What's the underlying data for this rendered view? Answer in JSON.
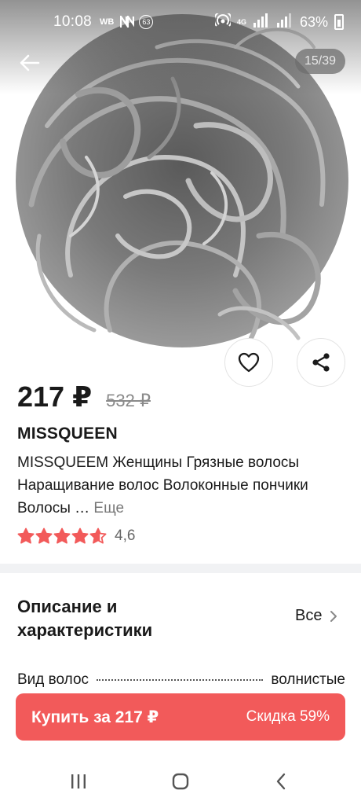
{
  "status_bar": {
    "time": "10:08",
    "carrier_badge": "WB",
    "notification_count": "63",
    "network_label": "4G",
    "battery": "63%"
  },
  "gallery": {
    "counter": "15/39",
    "image_description_icon": "hair-bun-photo"
  },
  "product": {
    "price": "217 ₽",
    "old_price": "532 ₽",
    "brand": "MISSQUEEN",
    "title": "MISSQUEEM Женщины Грязные волосы Наращивание волос Волоконные пончики Волосы …",
    "more_label": "Еще",
    "rating": 4.6,
    "rating_label": "4,6",
    "star_color": "#f25a5a"
  },
  "specs_section": {
    "title": "Описание и характеристики",
    "all_label": "Все",
    "rows": [
      {
        "name": "Вид волос",
        "value": "волнистые"
      }
    ]
  },
  "buy_bar": {
    "label": "Купить за 217 ₽",
    "discount": "Скидка 59%",
    "color": "#f25a5a"
  },
  "icons": {
    "back": "arrow-left-icon",
    "favorite": "heart-icon",
    "share": "share-icon",
    "chevron": "chevron-right-icon",
    "nav_recent": "recent-apps-icon",
    "nav_home": "home-icon",
    "nav_back": "nav-back-icon"
  }
}
